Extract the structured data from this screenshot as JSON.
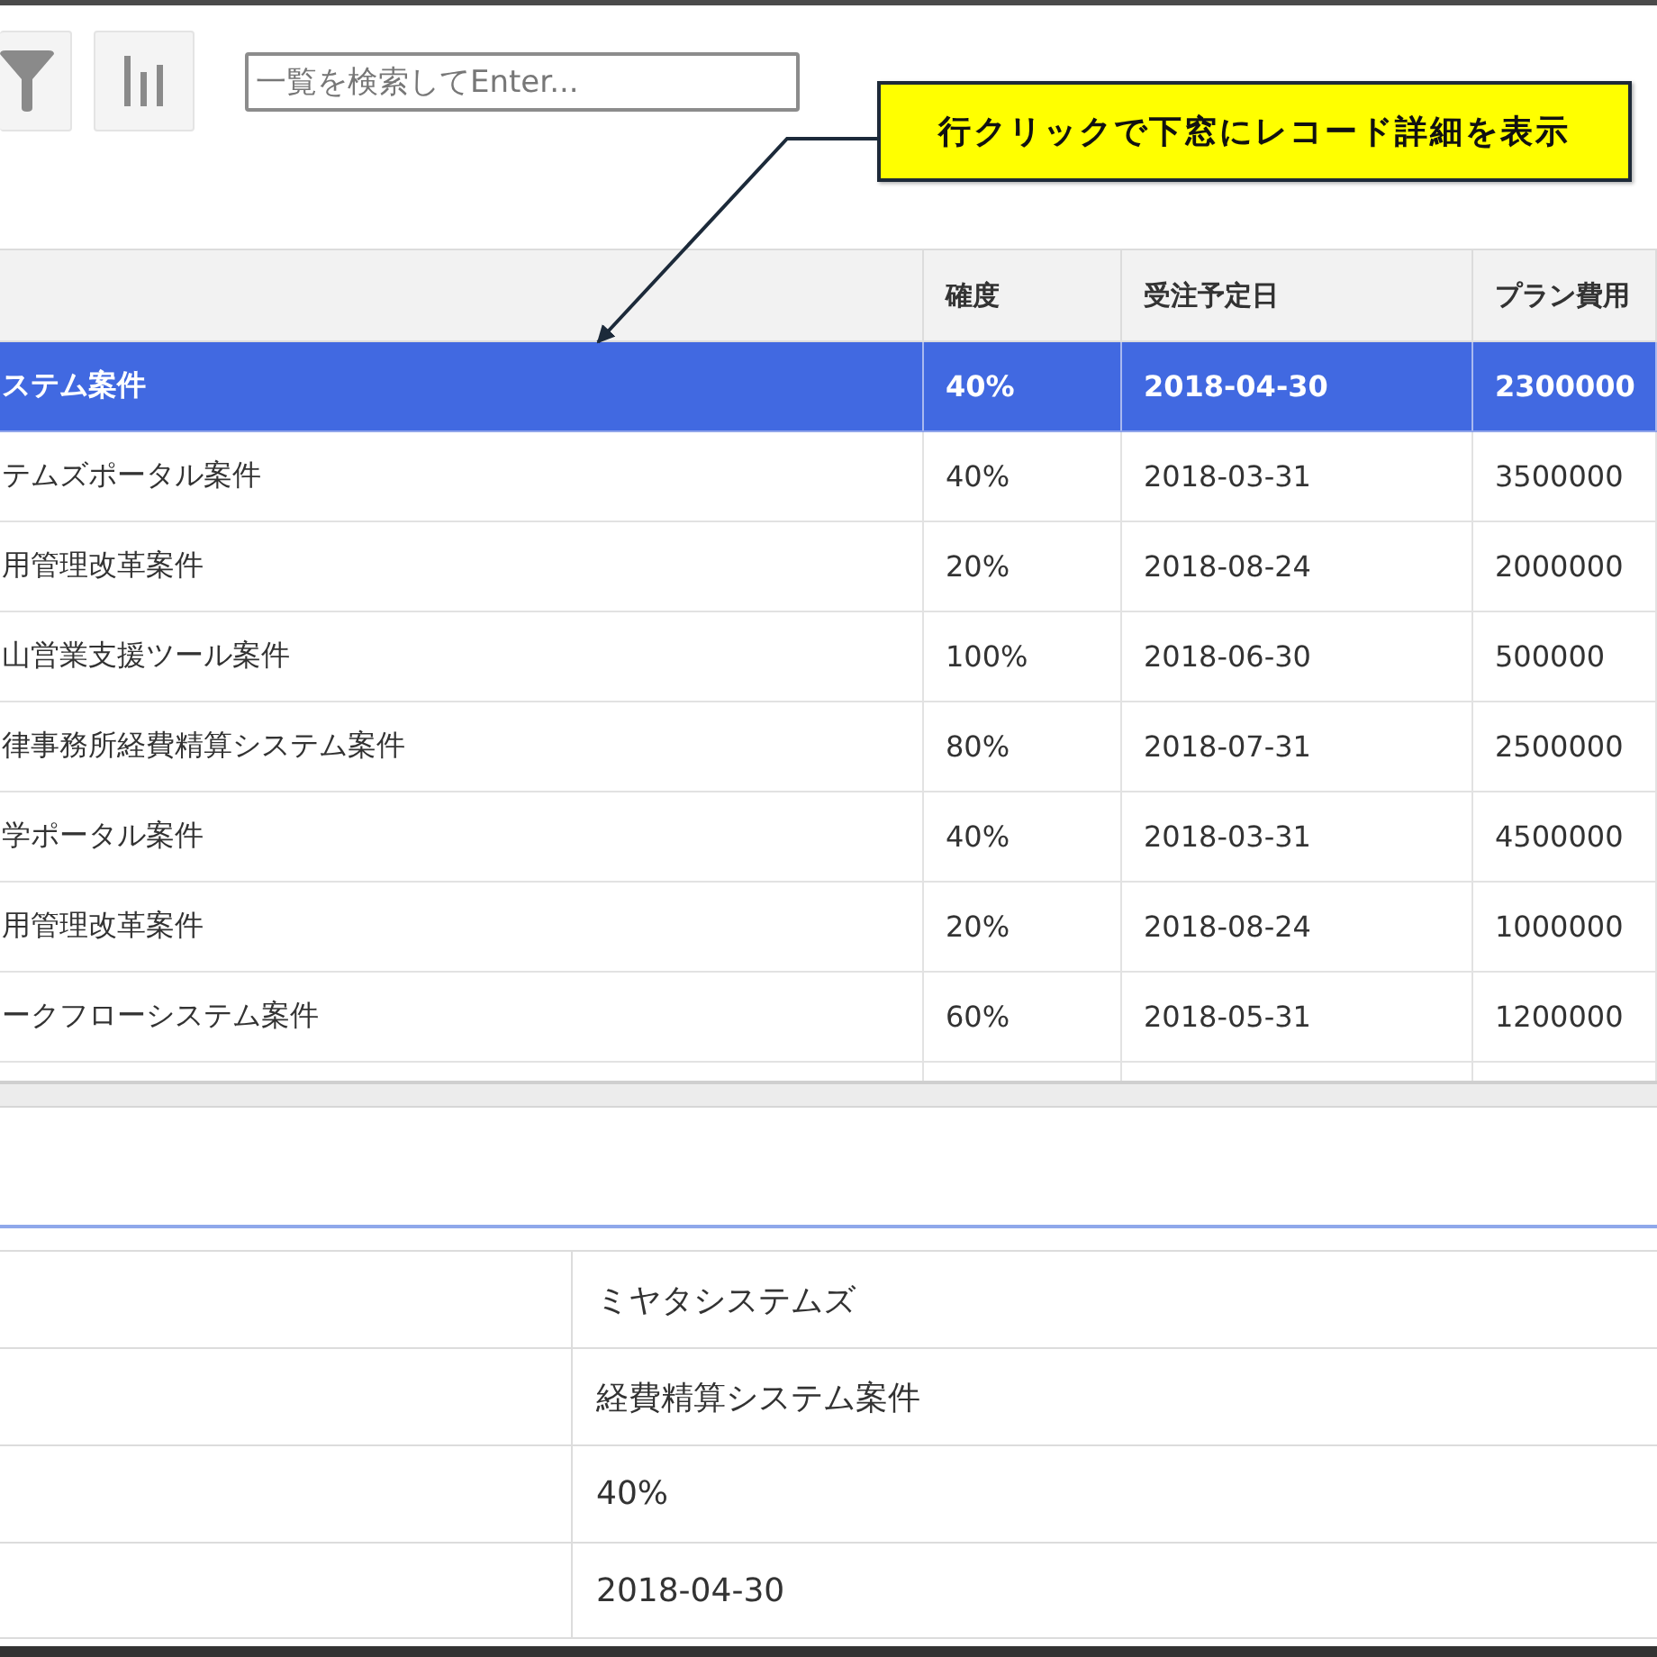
{
  "toolbar": {
    "buttons": [
      {
        "kind": "filter"
      },
      {
        "kind": "chart"
      }
    ],
    "search": {
      "placeholder": "一覧を検索してEnter..."
    }
  },
  "callout": {
    "text": "行クリックで下窓にレコード詳細を表示"
  },
  "table": {
    "columns": [
      "",
      "確度",
      "受注予定日",
      "プラン費用"
    ],
    "rows": [
      {
        "selected": true,
        "cells": [
          "ステム案件",
          "40%",
          "2018-04-30",
          "2300000"
        ]
      },
      {
        "selected": false,
        "cells": [
          "テムズポータル案件",
          "40%",
          "2018-03-31",
          "3500000"
        ]
      },
      {
        "selected": false,
        "cells": [
          "用管理改革案件",
          "20%",
          "2018-08-24",
          "2000000"
        ]
      },
      {
        "selected": false,
        "cells": [
          "山営業支援ツール案件",
          "100%",
          "2018-06-30",
          "500000"
        ]
      },
      {
        "selected": false,
        "cells": [
          "律事務所経費精算システム案件",
          "80%",
          "2018-07-31",
          "2500000"
        ]
      },
      {
        "selected": false,
        "cells": [
          "学ポータル案件",
          "40%",
          "2018-03-31",
          "4500000"
        ]
      },
      {
        "selected": false,
        "cells": [
          "用管理改革案件",
          "20%",
          "2018-08-24",
          "1000000"
        ]
      },
      {
        "selected": false,
        "cells": [
          "ークフローシステム案件",
          "60%",
          "2018-05-31",
          "1200000"
        ]
      }
    ]
  },
  "detail": {
    "values": [
      "ミヤタシステムズ",
      "経費精算システム案件",
      "40%",
      "2018-04-30"
    ]
  }
}
